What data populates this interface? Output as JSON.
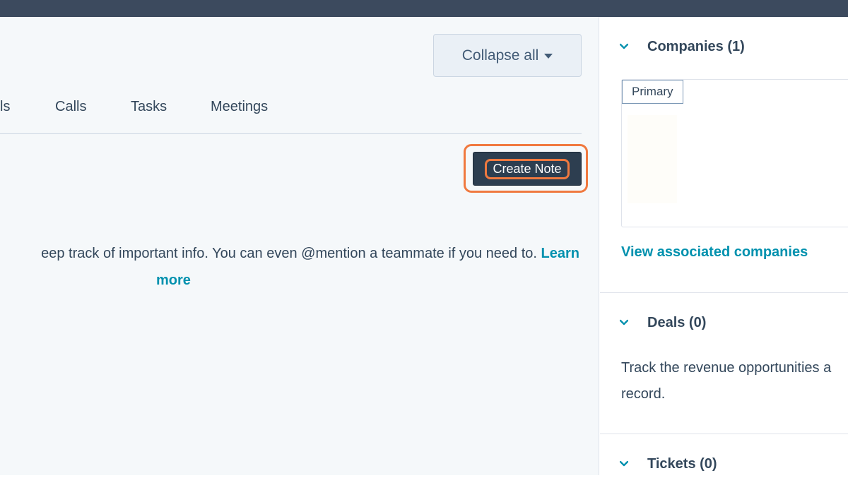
{
  "toolbar": {
    "collapse_label": "Collapse all"
  },
  "tabs": [
    {
      "label": "ls"
    },
    {
      "label": "Calls"
    },
    {
      "label": "Tasks"
    },
    {
      "label": "Meetings"
    }
  ],
  "notes": {
    "create_label": "Create Note",
    "empty_text": "eep track of important info. You can even @mention a teammate if you need to.",
    "learn_label": "Learn",
    "more_label": "more"
  },
  "sidebar": {
    "companies": {
      "title": "Companies (1)",
      "badge": "Primary",
      "view_link": "View associated companies"
    },
    "deals": {
      "title": "Deals (0)",
      "description_line1": "Track the revenue opportunities a",
      "description_line2": "record."
    },
    "tickets": {
      "title": "Tickets (0)"
    }
  },
  "colors": {
    "accent": "#0091ae",
    "highlight": "#f0793f",
    "primary_button": "#2d3e50"
  }
}
